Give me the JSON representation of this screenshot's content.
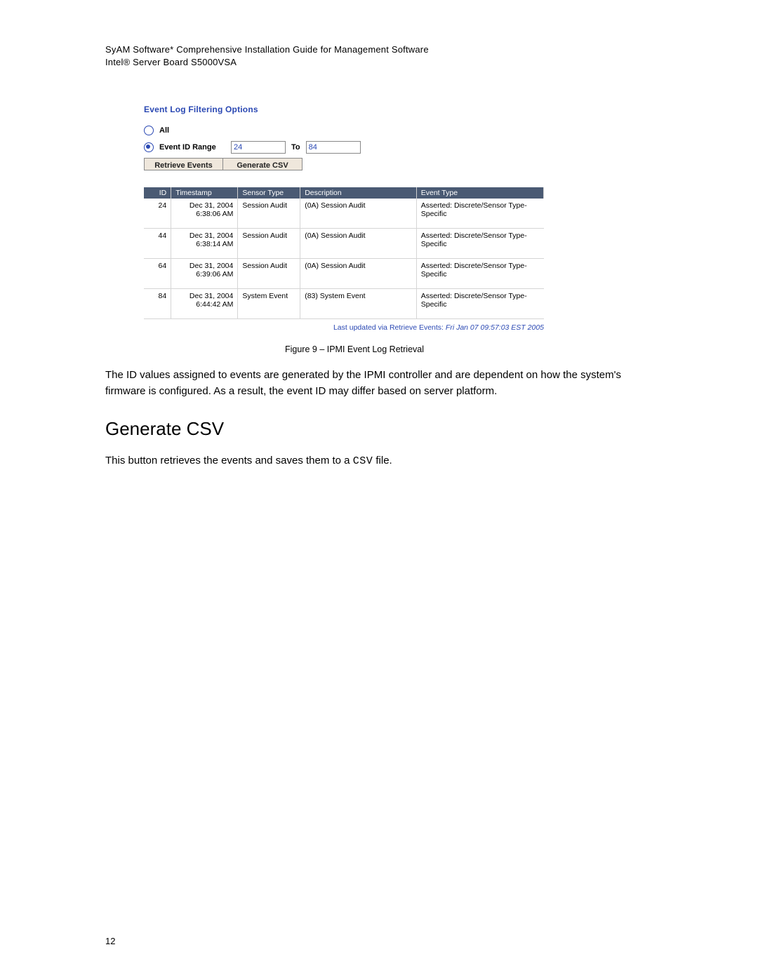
{
  "doc": {
    "header_line1": "SyAM Software* Comprehensive Installation Guide for Management Software",
    "header_line2": "Intel® Server Board S5000VSA",
    "page_number": "12"
  },
  "fig": {
    "title": "Event Log Filtering Options",
    "radio_all_label": "All",
    "radio_range_label": "Event ID Range",
    "range_from": "24",
    "range_to_label": "To",
    "range_to": "84",
    "btn_retrieve": "Retrieve Events",
    "btn_csv": "Generate CSV",
    "table_headers": {
      "id": "ID",
      "timestamp": "Timestamp",
      "sensor_type": "Sensor Type",
      "description": "Description",
      "event_type": "Event Type"
    },
    "rows": [
      {
        "id": "24",
        "ts1": "Dec 31, 2004",
        "ts2": "6:38:06 AM",
        "sensor": "Session Audit",
        "desc": "(0A) Session Audit",
        "etype": "Asserted: Discrete/Sensor Type-Specific"
      },
      {
        "id": "44",
        "ts1": "Dec 31, 2004",
        "ts2": "6:38:14 AM",
        "sensor": "Session Audit",
        "desc": "(0A) Session Audit",
        "etype": "Asserted: Discrete/Sensor Type-Specific"
      },
      {
        "id": "64",
        "ts1": "Dec 31, 2004",
        "ts2": "6:39:06 AM",
        "sensor": "Session Audit",
        "desc": "(0A) Session Audit",
        "etype": "Asserted: Discrete/Sensor Type-Specific"
      },
      {
        "id": "84",
        "ts1": "Dec 31, 2004",
        "ts2": "6:44:42 AM",
        "sensor": "System Event",
        "desc": "(83) System Event",
        "etype": "Asserted: Discrete/Sensor Type-Specific"
      }
    ],
    "status_prefix": "Last updated via Retrieve Events: ",
    "status_time": "Fri Jan 07 09:57:03 EST 2005",
    "caption": "Figure 9 – IPMI Event Log Retrieval"
  },
  "body": {
    "p1": "The ID values assigned to events are generated by the IPMI controller and are dependent on how the system's firmware is configured. As a result, the event ID may differ based on server platform.",
    "h2": "Generate CSV",
    "p2_a": "This button retrieves the events and saves them to a ",
    "p2_b": "CSV",
    "p2_c": " file."
  }
}
